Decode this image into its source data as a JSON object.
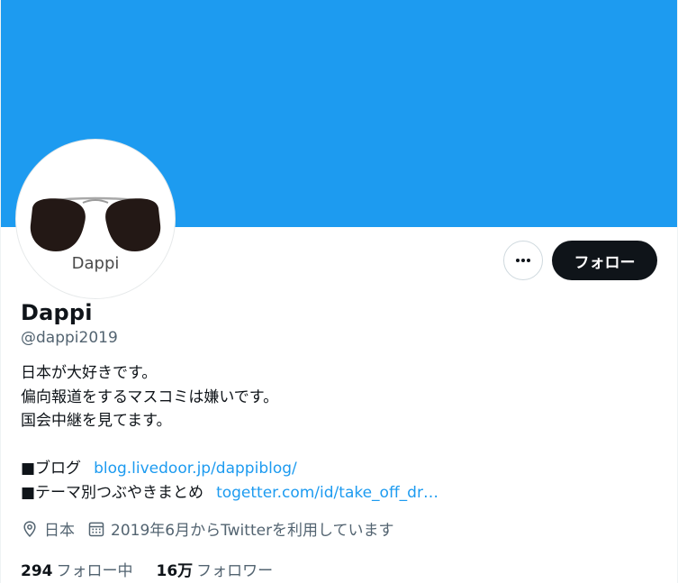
{
  "colors": {
    "banner": "#1d9bf0",
    "link": "#1d9bf0",
    "primary_text": "#0f1419",
    "secondary_text": "#536471",
    "follow_button_bg": "#0f1419"
  },
  "avatar": {
    "logo_text": "Dappi",
    "icon": "sunglasses-logo"
  },
  "actions": {
    "more_icon": "more-dots-icon",
    "follow_label": "フォロー"
  },
  "profile": {
    "display_name": "Dappi",
    "handle": "@dappi2019"
  },
  "bio": {
    "line1": "日本が大好きです。",
    "line2": "偏向報道をするマスコミは嫌いです。",
    "line3": "国会中継を見てます。",
    "blog_label": "■ブログ",
    "blog_link": "blog.livedoor.jp/dappiblog/",
    "matome_label": "■テーマ別つぶやきまとめ",
    "matome_link": "togetter.com/id/take_off_dr…"
  },
  "meta": {
    "location": "日本",
    "location_icon": "location-pin-icon",
    "joined": "2019年6月からTwitterを利用しています",
    "joined_icon": "calendar-icon"
  },
  "stats": {
    "following_count": "294",
    "following_label": "フォロー中",
    "followers_count": "16万",
    "followers_label": "フォロワー"
  }
}
